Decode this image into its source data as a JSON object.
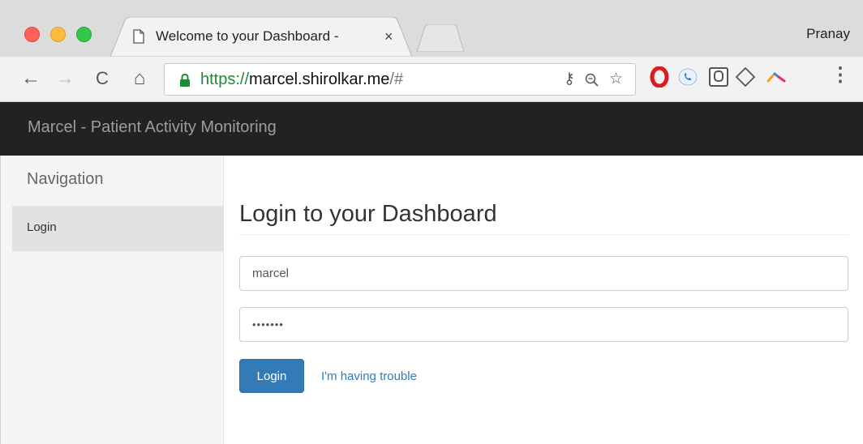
{
  "browser": {
    "tab_title": "Welcome to your Dashboard - ",
    "tab_close": "×",
    "profile_name": "Pranay",
    "url": {
      "scheme": "https://",
      "host": "marcel.shirolkar.me",
      "path": "/#"
    },
    "icons": [
      "back-icon",
      "forward-icon",
      "reload-icon",
      "home-icon",
      "lock-icon",
      "key-icon",
      "zoom-icon",
      "bookmark-star-icon",
      "opera-icon",
      "phone-extension-icon",
      "extension-square-icon",
      "diamond-icon",
      "extension-arc-icon",
      "menu-icon"
    ],
    "colors": {
      "secure": "#1a8a33",
      "tabstrip": "#dcdcdc",
      "toolbar": "#f2f2f2"
    }
  },
  "app": {
    "brand": "Marcel - Patient Activity Monitoring",
    "navbar_color": "#222222"
  },
  "sidebar": {
    "heading": "Navigation",
    "items": [
      {
        "label": "Login",
        "active": true
      }
    ]
  },
  "login": {
    "heading": "Login to your Dashboard",
    "username_value": "marcel",
    "password_value": "•••••••",
    "submit_label": "Login",
    "help_link": "I'm having trouble",
    "accent": "#337ab7"
  }
}
